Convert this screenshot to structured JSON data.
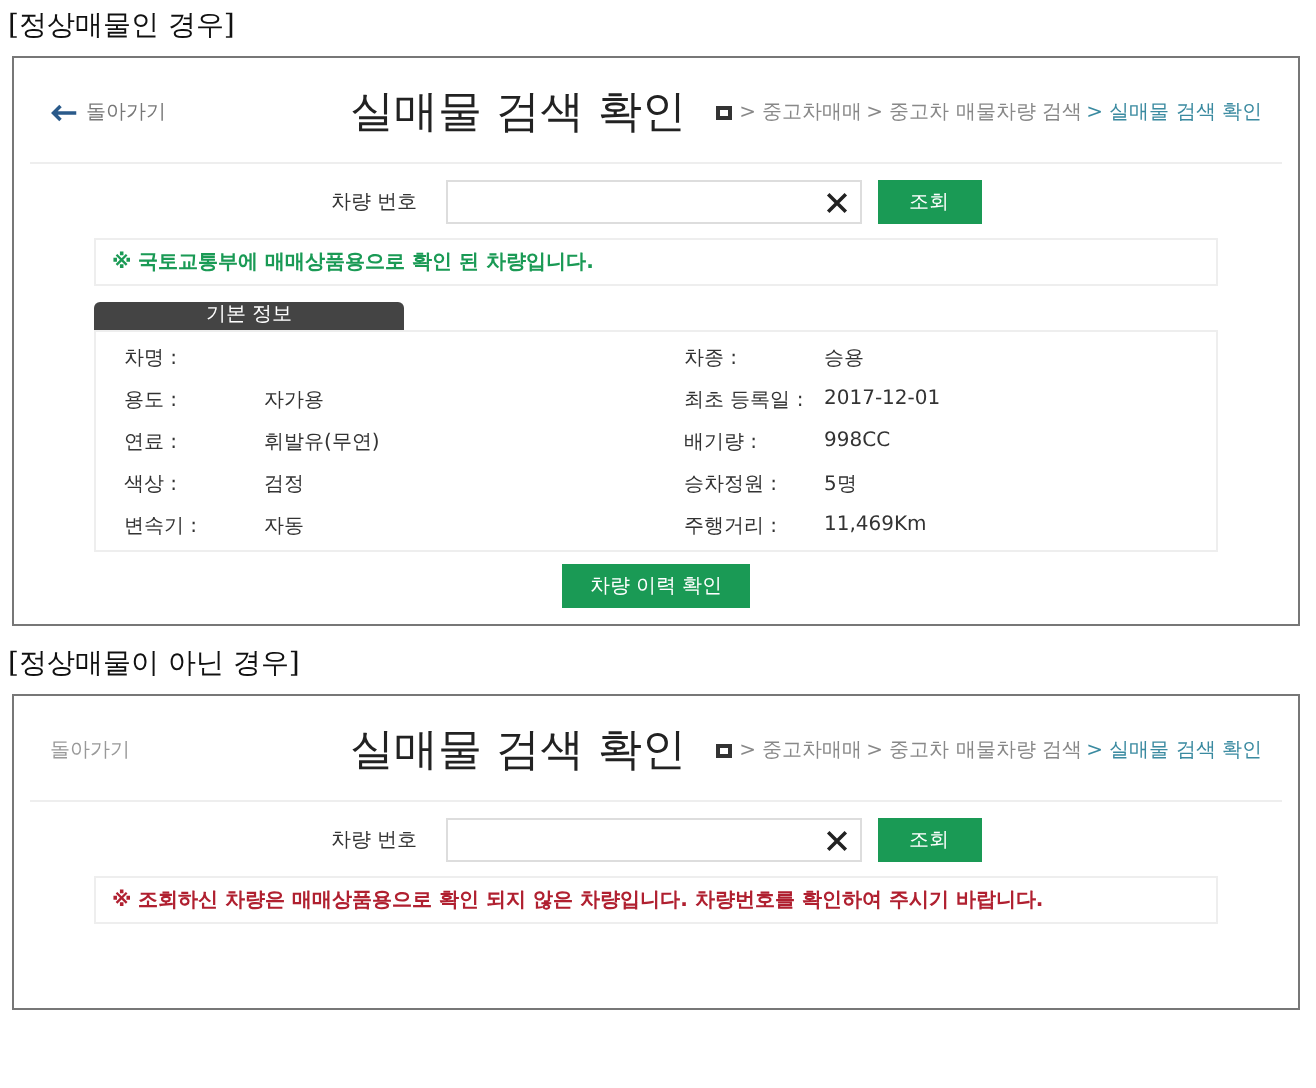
{
  "screens": [
    {
      "caption": "[정상매물인 경우]",
      "back": {
        "label": "돌아가기",
        "arrow": true
      },
      "title": "실매물 검색 확인",
      "breadcrumb": [
        {
          "text": "> 중고차매매",
          "current": false
        },
        {
          "text": "> 중고차 매물차량 검색",
          "current": false
        },
        {
          "text": "> 실매물 검색 확인",
          "current": true
        }
      ],
      "search": {
        "label": "차량 번호",
        "button": "조회"
      },
      "notice": {
        "kind": "success",
        "text": "※ 국토교통부에 매매상품용으로 확인 된 차량입니다."
      },
      "info": {
        "tab": "기본 정보",
        "rows": [
          {
            "label": "차명 :",
            "label2": "차종 :",
            "value2": "승용"
          },
          {
            "label": "용도 :",
            "value": "자가용",
            "label2": "최초 등록일 :",
            "value2": "2017-12-01"
          },
          {
            "label": "연료 :",
            "value": "휘발유(무연)",
            "label2": "배기량 :",
            "value2": "998CC"
          },
          {
            "label": "색상 :",
            "value": "검정",
            "label2": "승차정원 :",
            "value2": "5명"
          },
          {
            "label": "변속기 :",
            "value": "자동",
            "label2": "주행거리 :",
            "value2": "11,469Km"
          }
        ]
      },
      "history_button": "차량 이력 확인"
    },
    {
      "caption": "[정상매물이 아닌 경우]",
      "back": {
        "label": "돌아가기",
        "arrow": false
      },
      "title": "실매물 검색 확인",
      "breadcrumb": [
        {
          "text": "> 중고차매매",
          "current": false
        },
        {
          "text": "> 중고차 매물차량 검색",
          "current": false
        },
        {
          "text": "> 실매물 검색 확인",
          "current": true
        }
      ],
      "search": {
        "label": "차량 번호",
        "button": "조회"
      },
      "notice": {
        "kind": "error",
        "text": "※ 조회하신 차량은 매매상품용으로 확인 되지 않은 차량입니다. 차량번호를 확인하여 주시기 바랍니다."
      }
    }
  ]
}
